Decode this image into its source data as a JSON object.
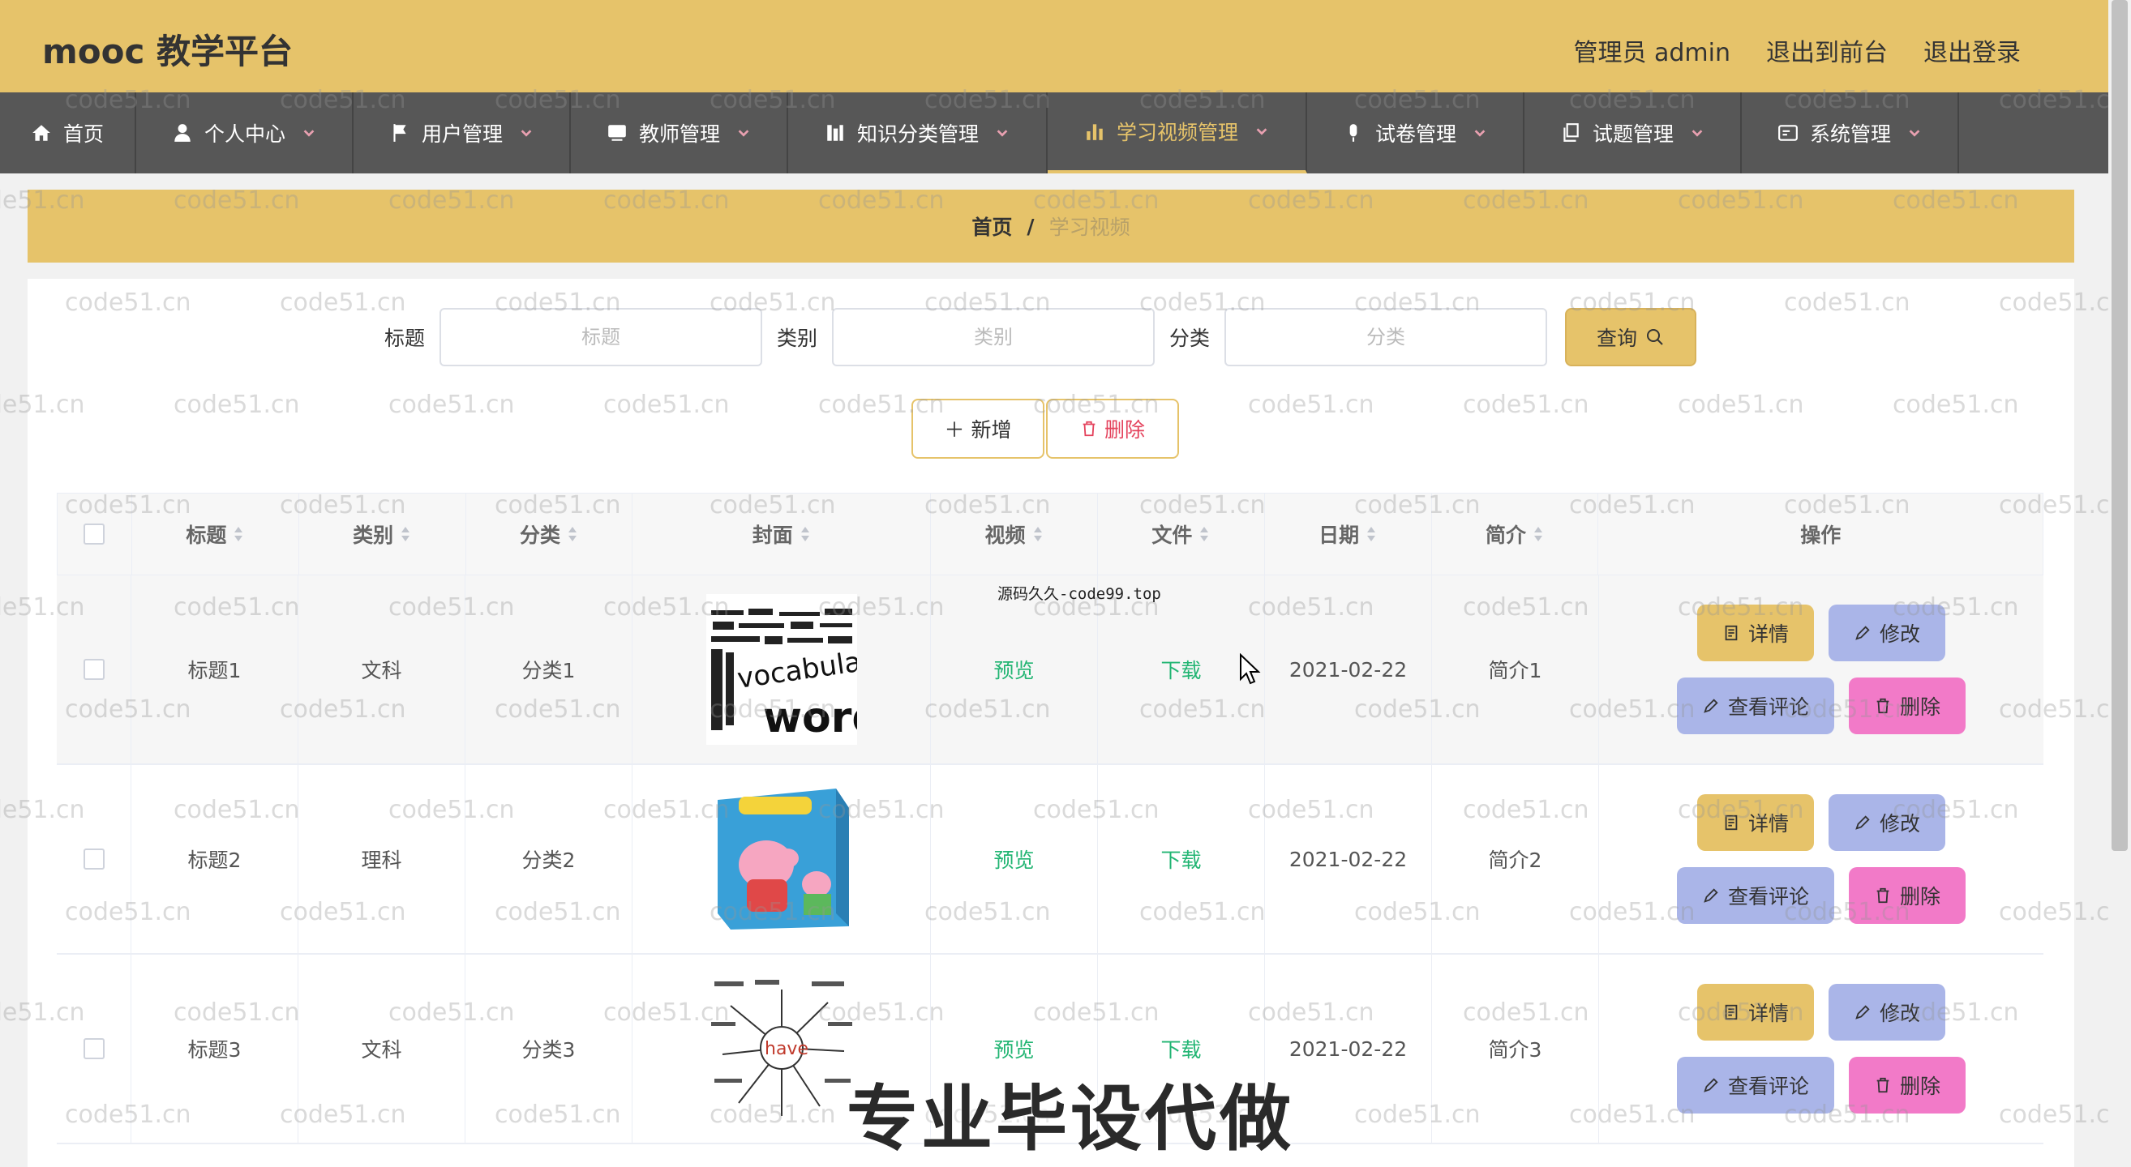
{
  "header": {
    "brand": "mooc 教学平台",
    "admin_label": "管理员 admin",
    "back_front": "退出到前台",
    "logout": "退出登录"
  },
  "nav": [
    {
      "label": "首页",
      "icon": "home-icon"
    },
    {
      "label": "个人中心",
      "icon": "user-icon"
    },
    {
      "label": "用户管理",
      "icon": "flag-icon"
    },
    {
      "label": "教师管理",
      "icon": "monitor-icon"
    },
    {
      "label": "知识分类管理",
      "icon": "bars-icon"
    },
    {
      "label": "学习视频管理",
      "icon": "chart-icon",
      "active": true
    },
    {
      "label": "试卷管理",
      "icon": "mic-icon"
    },
    {
      "label": "试题管理",
      "icon": "copy-icon"
    },
    {
      "label": "系统管理",
      "icon": "panel-icon"
    }
  ],
  "breadcrumb": {
    "home": "首页",
    "sep": "/",
    "current": "学习视频"
  },
  "search": {
    "title_label": "标题",
    "title_placeholder": "标题",
    "category_label": "类别",
    "category_placeholder": "类别",
    "class_label": "分类",
    "class_placeholder": "分类",
    "query_button": "查询"
  },
  "actions": {
    "add": "新增",
    "delete": "删除"
  },
  "table": {
    "headers": [
      "标题",
      "类别",
      "分类",
      "封面",
      "视频",
      "文件",
      "日期",
      "简介",
      "操作"
    ],
    "rows": [
      {
        "title": "标题1",
        "category": "文科",
        "class": "分类1",
        "video": "预览",
        "file": "下载",
        "date": "2021-02-22",
        "intro": "简介1",
        "cover": "words-cover"
      },
      {
        "title": "标题2",
        "category": "理科",
        "class": "分类2",
        "video": "预览",
        "file": "下载",
        "date": "2021-02-22",
        "intro": "简介2",
        "cover": "peppa-cover"
      },
      {
        "title": "标题3",
        "category": "文科",
        "class": "分类3",
        "video": "预览",
        "file": "下载",
        "date": "2021-02-22",
        "intro": "简介3",
        "cover": "have-cover"
      }
    ],
    "ops": {
      "detail": "详情",
      "edit": "修改",
      "comment": "查看评论",
      "remove": "删除"
    }
  },
  "overlays": {
    "source": "源码久久-code99.top",
    "promo": "专业毕设代做",
    "watermark": "code51.cn"
  }
}
